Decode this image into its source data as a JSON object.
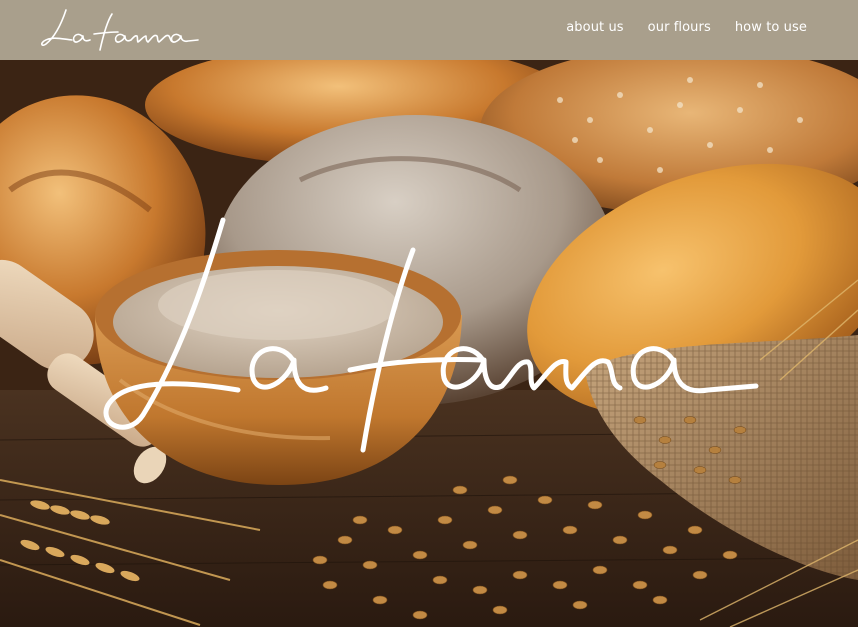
{
  "brand": {
    "name": "La farina",
    "logo_icon": "script-logo"
  },
  "nav": {
    "items": [
      {
        "label": "about us"
      },
      {
        "label": "our flours"
      },
      {
        "label": "how to use"
      }
    ]
  },
  "hero": {
    "wordmark": "La farina",
    "photo_subject": "bread-flour-wheat-photo"
  },
  "colors": {
    "header_bg": "#a99f8c",
    "nav_text": "#ffffff"
  }
}
